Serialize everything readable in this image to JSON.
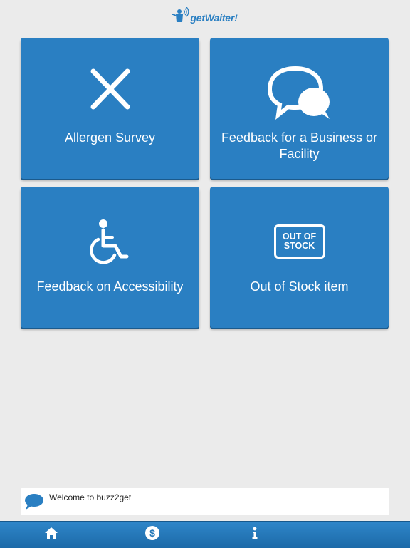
{
  "header": {
    "logo_text": "getWaiter!",
    "logo_icon": "waiter-icon"
  },
  "tiles": [
    {
      "label": "Allergen Survey",
      "icon": "close-x-icon"
    },
    {
      "label": "Feedback for a Business or Facility",
      "icon": "chat-bubbles-icon"
    },
    {
      "label": "Feedback on Accessibility",
      "icon": "wheelchair-icon"
    },
    {
      "label": "Out of Stock item",
      "icon": "out-of-stock-icon",
      "icon_text_line1": "OUT OF",
      "icon_text_line2": "STOCK"
    }
  ],
  "welcome": {
    "message": "Welcome to buzz2get",
    "icon": "chat-bubble-icon"
  },
  "tabbar": [
    {
      "name": "home",
      "icon": "home-icon"
    },
    {
      "name": "payment",
      "icon": "dollar-badge-icon"
    },
    {
      "name": "info",
      "icon": "info-icon"
    }
  ],
  "colors": {
    "tile": "#2a7fc2",
    "background": "#ebebeb",
    "tabbar": "#2277b8"
  }
}
